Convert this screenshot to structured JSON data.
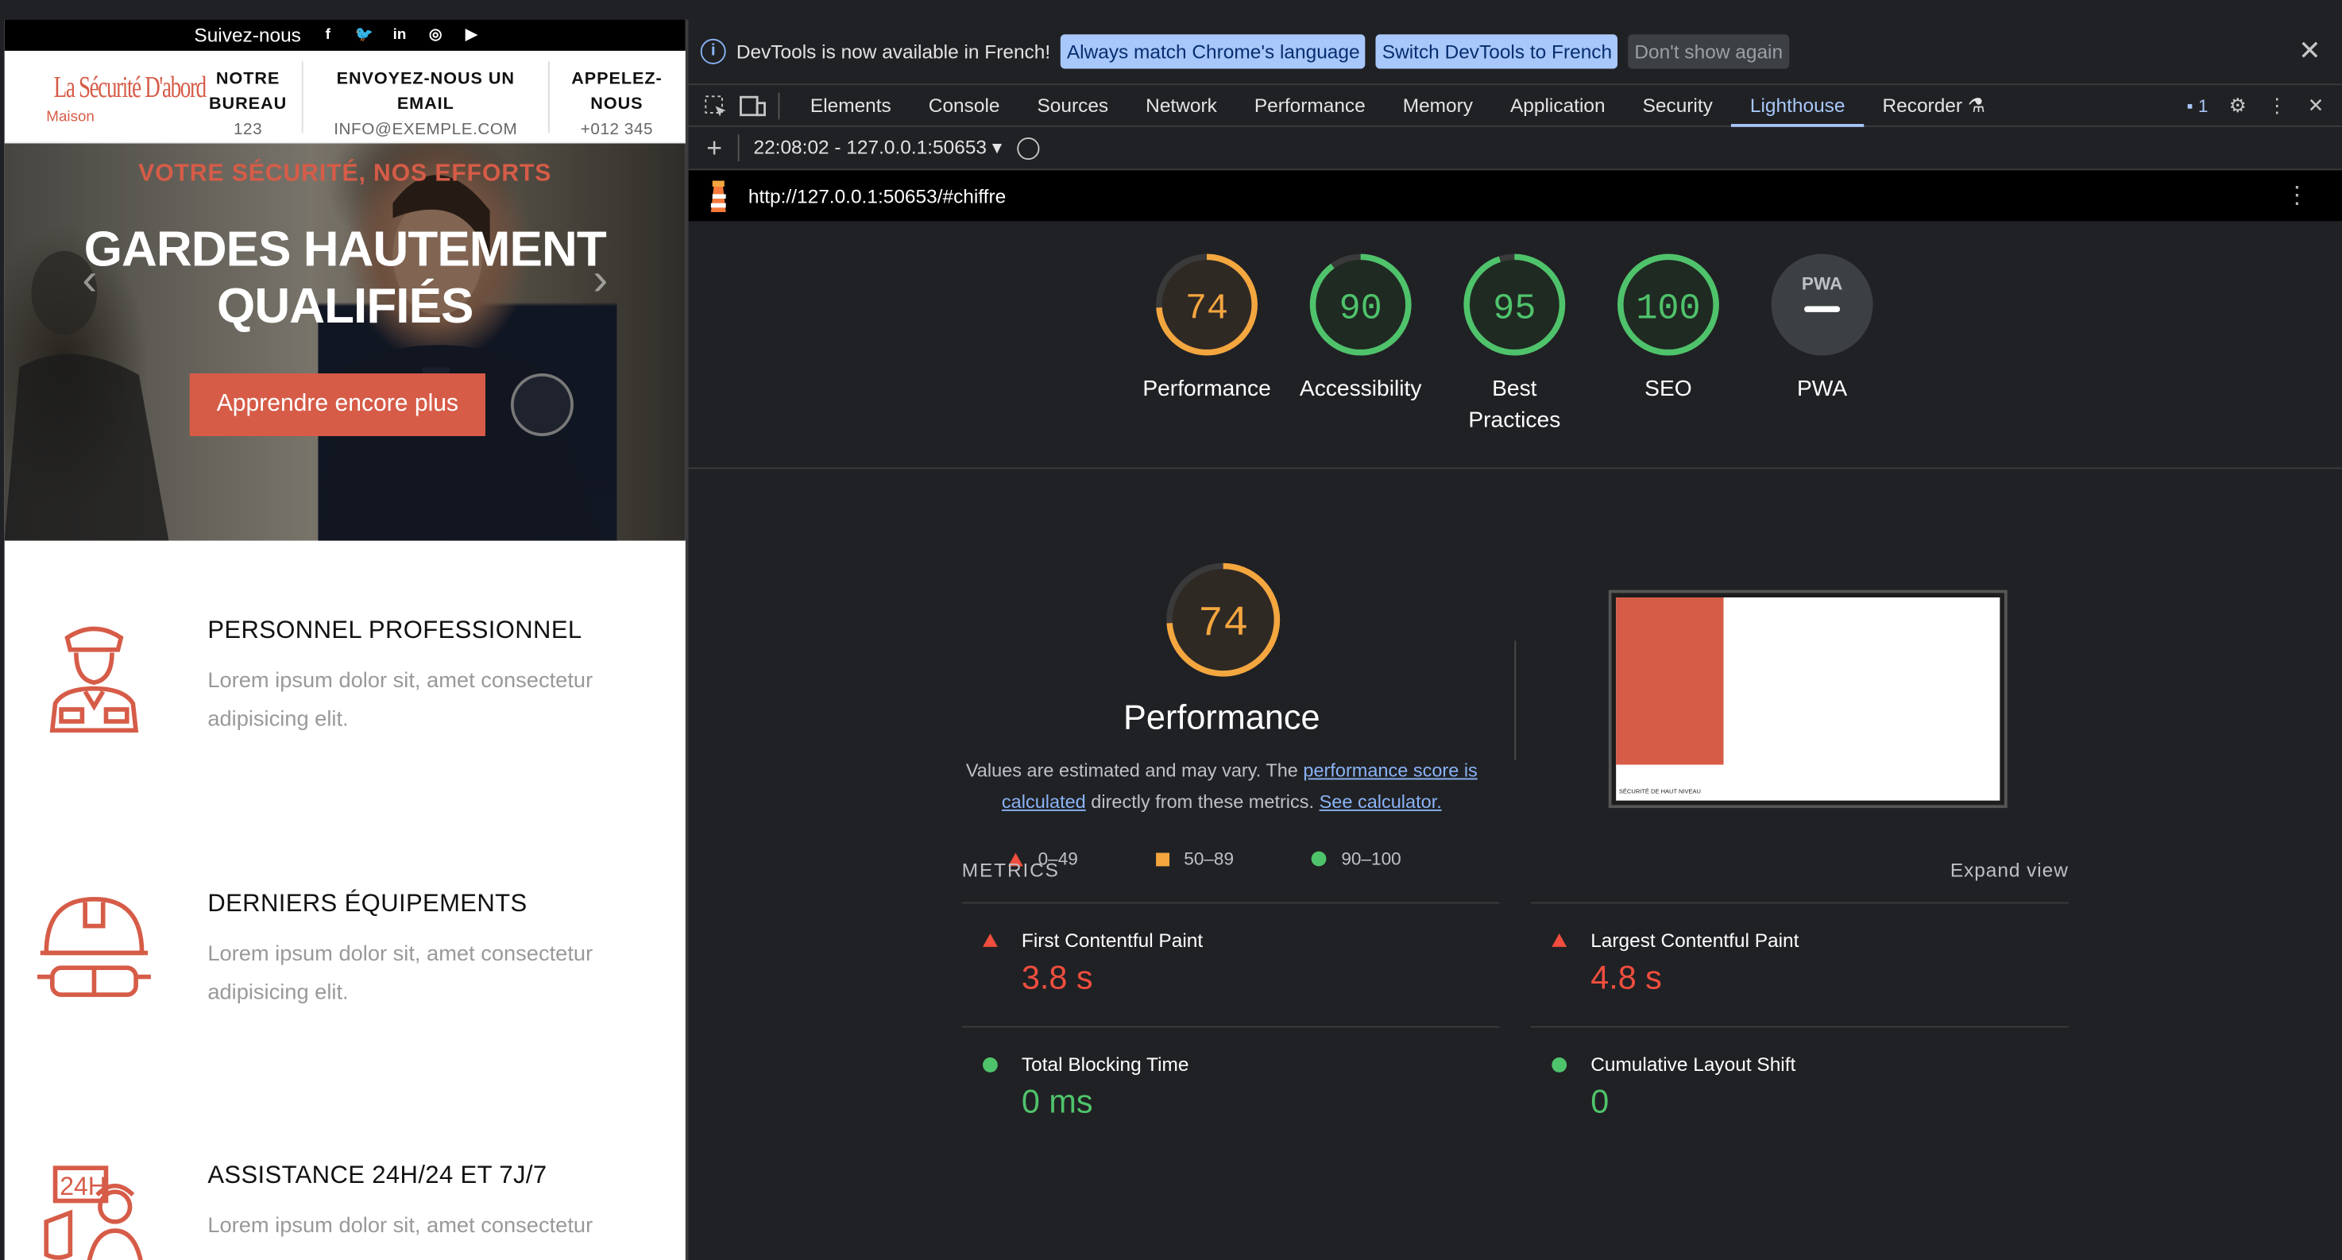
{
  "site": {
    "topbar": {
      "follow": "Suivez-nous",
      "social": [
        "f",
        "t",
        "in",
        "ig",
        "yt"
      ]
    },
    "logo": {
      "name": "La Sécurité D'abord",
      "sub": "Maison"
    },
    "header": [
      {
        "title": "NOTRE BUREAU",
        "value": "123"
      },
      {
        "title": "ENVOYEZ-NOUS UN EMAIL",
        "value": "INFO@EXEMPLE.COM"
      },
      {
        "title": "APPELEZ-NOUS",
        "value": "+012 345"
      }
    ],
    "hero": {
      "subtitle": "VOTRE SÉCURITÉ, NOS EFFORTS",
      "title": "GARDES HAUTEMENT QUALIFIÉS",
      "button": "Apprendre encore plus"
    },
    "features": [
      {
        "title": "PERSONNEL PROFESSIONNEL",
        "text": "Lorem ipsum dolor sit, amet consectetur adipisicing elit."
      },
      {
        "title": "DERNIERS ÉQUIPEMENTS",
        "text": "Lorem ipsum dolor sit, amet consectetur adipisicing elit."
      },
      {
        "title": "ASSISTANCE 24H/24 ET 7J/7",
        "text": "Lorem ipsum dolor sit, amet consectetur"
      }
    ]
  },
  "devtools": {
    "infobar": {
      "message": "DevTools is now available in French!",
      "btn_match": "Always match Chrome's language",
      "btn_switch": "Switch DevTools to French",
      "btn_dismiss": "Don't show again"
    },
    "tabs": [
      "Elements",
      "Console",
      "Sources",
      "Network",
      "Performance",
      "Memory",
      "Application",
      "Security",
      "Lighthouse",
      "Recorder"
    ],
    "active_tab": "Lighthouse",
    "issues_count": "1",
    "report_selector": "22:08:02 - 127.0.0.1:50653",
    "url": "http://127.0.0.1:50653/#chiffre",
    "scores": [
      {
        "label": "Performance",
        "score": 74,
        "color": "#f4a63f"
      },
      {
        "label": "Accessibility",
        "score": 90,
        "color": "#4fc36b"
      },
      {
        "label": "Best Practices",
        "score": 95,
        "color": "#4fc36b"
      },
      {
        "label": "SEO",
        "score": 100,
        "color": "#4fc36b"
      },
      {
        "label": "PWA",
        "score": null,
        "color": "#9aa0a6",
        "badge": "PWA"
      }
    ],
    "performance": {
      "score": 74,
      "title": "Performance",
      "desc_pre": "Values are estimated and may vary. The ",
      "desc_link1": "performance score is calculated",
      "desc_mid": " directly from these metrics. ",
      "desc_link2": "See calculator."
    },
    "legend": [
      "0–49",
      "50–89",
      "90–100"
    ],
    "thumbnail_caption": "SÉCURITÉ DE HAUT NIVEAU",
    "metrics": {
      "header": "METRICS",
      "expand": "Expand view",
      "items": [
        {
          "name": "First Contentful Paint",
          "value": "3.8 s",
          "status": "fail"
        },
        {
          "name": "Largest Contentful Paint",
          "value": "4.8 s",
          "status": "fail"
        },
        {
          "name": "Total Blocking Time",
          "value": "0 ms",
          "status": "pass"
        },
        {
          "name": "Cumulative Layout Shift",
          "value": "0",
          "status": "pass"
        }
      ]
    }
  }
}
